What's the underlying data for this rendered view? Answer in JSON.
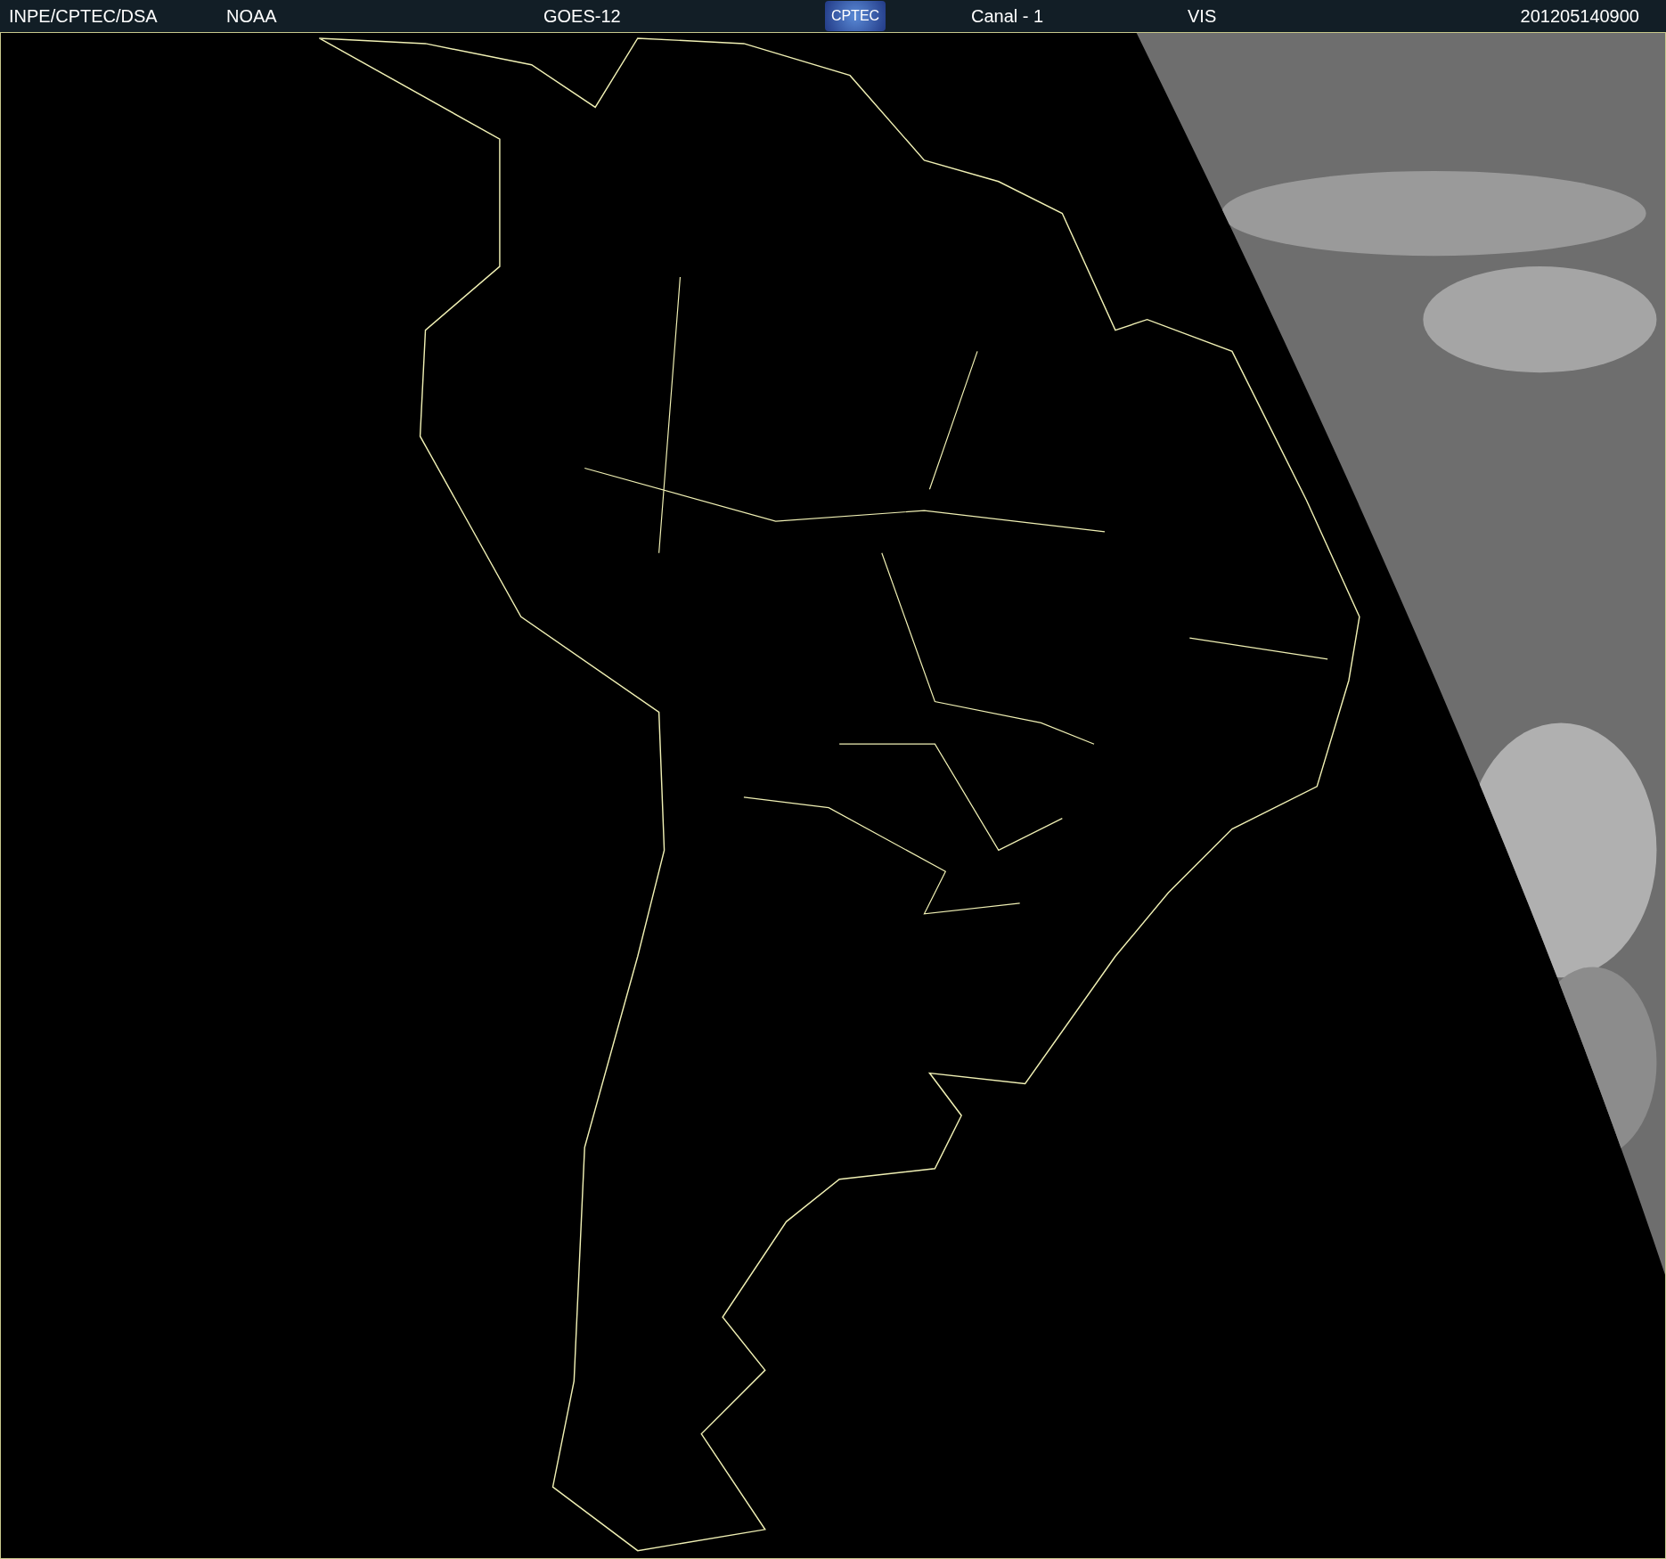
{
  "header": {
    "source": "INPE/CPTEC/DSA",
    "agency": "NOAA",
    "satellite": "GOES-12",
    "logo": "CPTEC",
    "channel": "Canal - 1",
    "band": "VIS",
    "timestamp": "201205140900"
  }
}
